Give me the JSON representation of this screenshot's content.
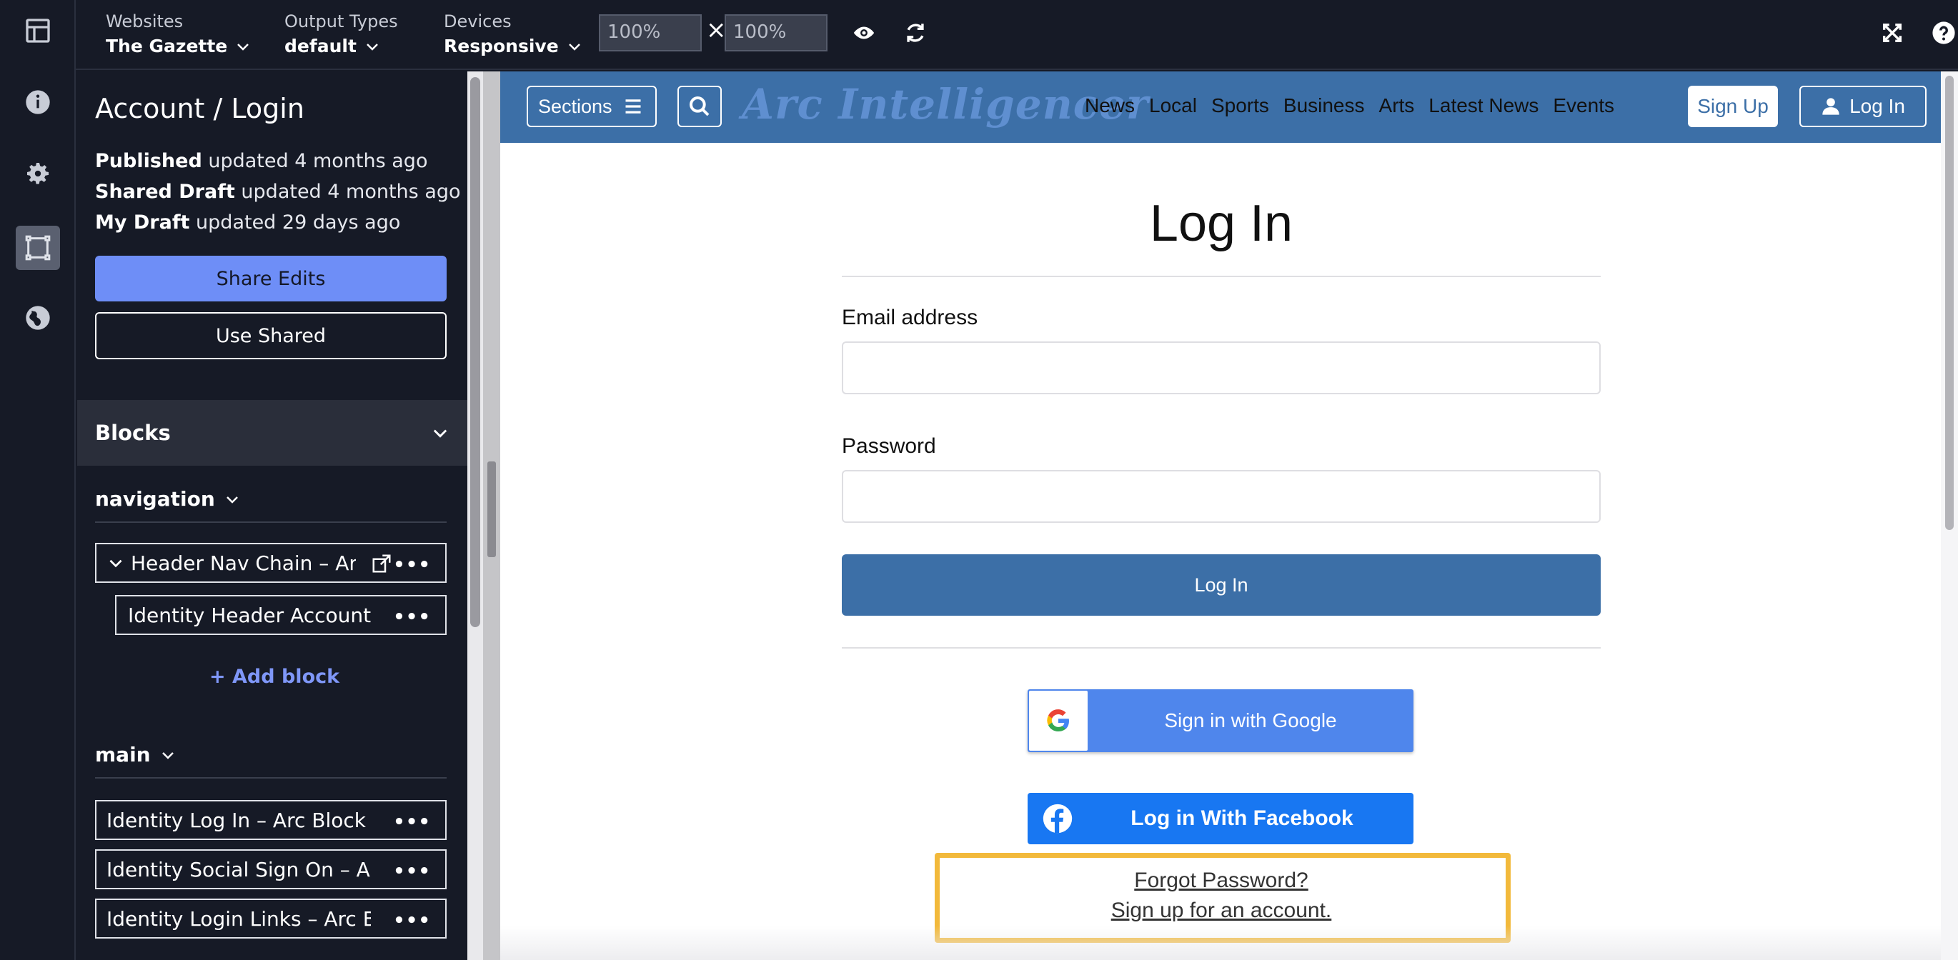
{
  "topbar": {
    "websites": {
      "label": "Websites",
      "value": "The Gazette"
    },
    "output_types": {
      "label": "Output Types",
      "value": "default"
    },
    "devices": {
      "label": "Devices",
      "value": "Responsive"
    },
    "width_value": "100%",
    "height_value": "100%",
    "times": "×"
  },
  "rail": {
    "icons": [
      "layout-icon",
      "info-icon",
      "gear-icon",
      "resize-icon",
      "globe-icon"
    ]
  },
  "panel": {
    "title": "Account / Login",
    "status": [
      {
        "bold": "Published",
        "rest": " updated 4 months ago"
      },
      {
        "bold": "Shared Draft",
        "rest": " updated 4 months ago"
      },
      {
        "bold": "My Draft",
        "rest": " updated 29 days ago"
      }
    ],
    "share_edits": "Share Edits",
    "use_shared": "Use Shared",
    "blocks_header": "Blocks",
    "navigation": {
      "label": "navigation",
      "items": [
        "Header Nav Chain – Arc",
        "Identity Header Account"
      ]
    },
    "add_block": "Add block",
    "add_plus": "+",
    "main": {
      "label": "main",
      "items": [
        "Identity Log In – Arc Block",
        "Identity Social Sign On – Arc Block",
        "Identity Login Links – Arc Block"
      ]
    },
    "dots": "•••"
  },
  "site": {
    "sections": "Sections",
    "logo": "Arc Intelligencer",
    "nav_links": [
      "News",
      "Local",
      "Sports",
      "Business",
      "Arts",
      "Latest News",
      "Events"
    ],
    "sign_up": "Sign Up",
    "log_in": "Log In"
  },
  "login_form": {
    "title": "Log In",
    "email_label": "Email address",
    "email_value": "",
    "password_label": "Password",
    "password_value": "",
    "submit": "Log In",
    "google": "Sign in with Google",
    "facebook": "Log in With Facebook",
    "forgot": "Forgot Password?",
    "signup": "Sign up for an account."
  },
  "colors": {
    "app_bg": "#161a26",
    "accent": "#6e8ef7",
    "site_blue": "#3c6fa7",
    "facebook": "#1877f2",
    "highlight": "#f2b93b"
  }
}
